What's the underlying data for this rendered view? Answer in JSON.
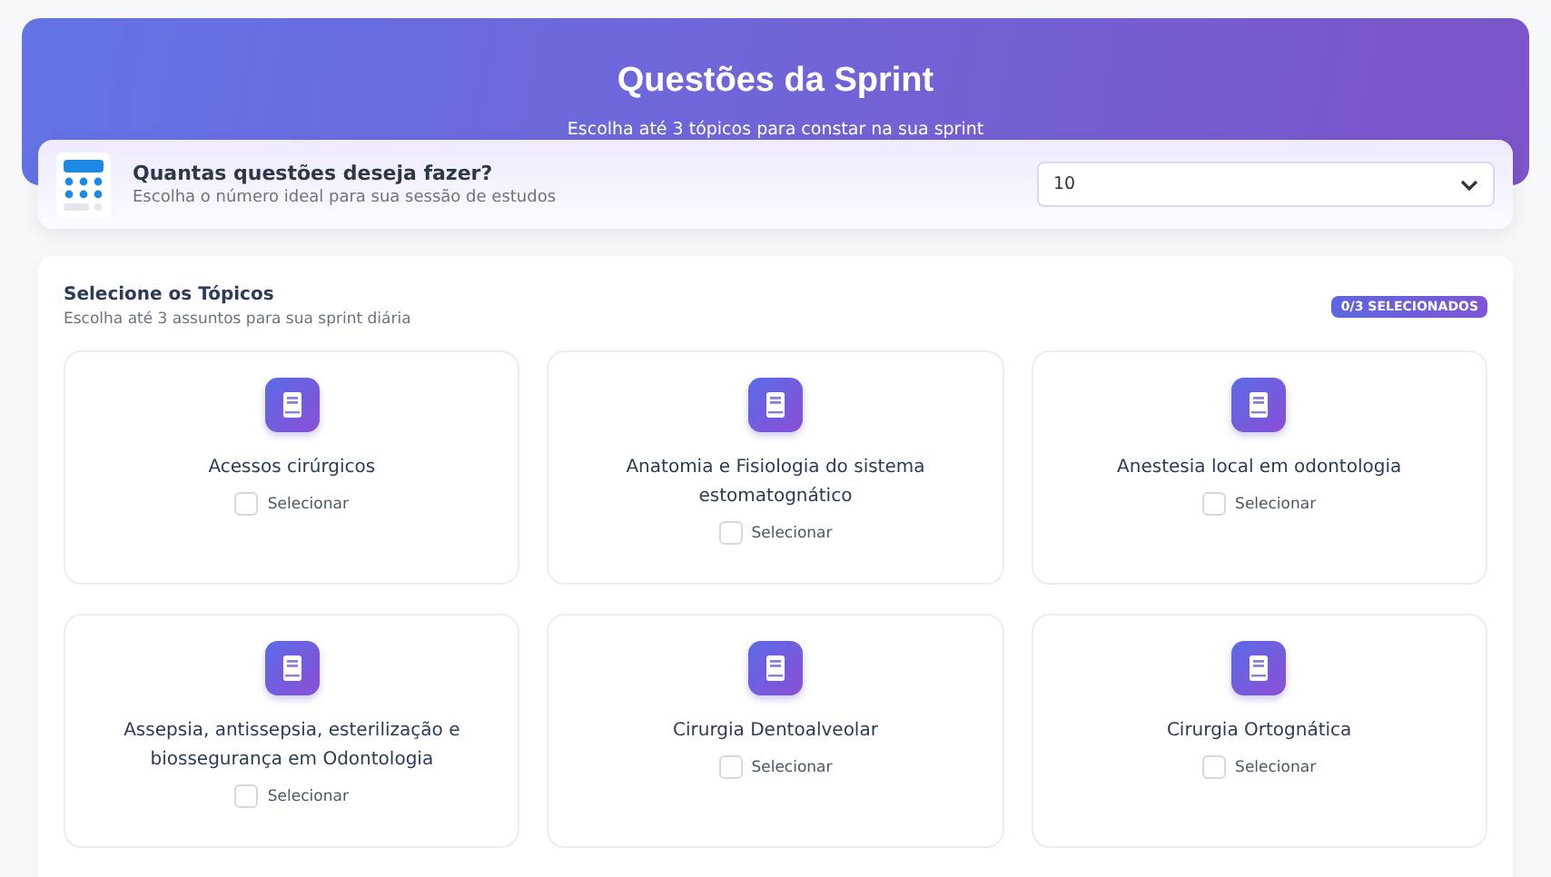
{
  "header": {
    "title": "Questões da Sprint",
    "subtitle": "Escolha até 3 tópicos para constar na sua sprint"
  },
  "question_count": {
    "title": "Quantas questões deseja fazer?",
    "subtitle": "Escolha o número ideal para sua sessão de estudos",
    "value": "10"
  },
  "topics": {
    "title": "Selecione os Tópicos",
    "subtitle": "Escolha até 3 assuntos para sua sprint diária",
    "badge": "0/3 SELECIONADOS",
    "items": [
      {
        "name": "Acessos cirúrgicos",
        "checkbox_label": "Selecionar",
        "checked": false
      },
      {
        "name": "Anatomia e Fisiologia do sistema estomatognático",
        "checkbox_label": "Selecionar",
        "checked": false
      },
      {
        "name": "Anestesia local em odontologia",
        "checkbox_label": "Selecionar",
        "checked": false
      },
      {
        "name": "Assepsia, antissepsia, esterilização e biossegurança em Odontologia",
        "checkbox_label": "Selecionar",
        "checked": false
      },
      {
        "name": "Cirurgia Dentoalveolar",
        "checkbox_label": "Selecionar",
        "checked": false
      },
      {
        "name": "Cirurgia Ortognática",
        "checkbox_label": "Selecionar",
        "checked": false
      }
    ]
  }
}
